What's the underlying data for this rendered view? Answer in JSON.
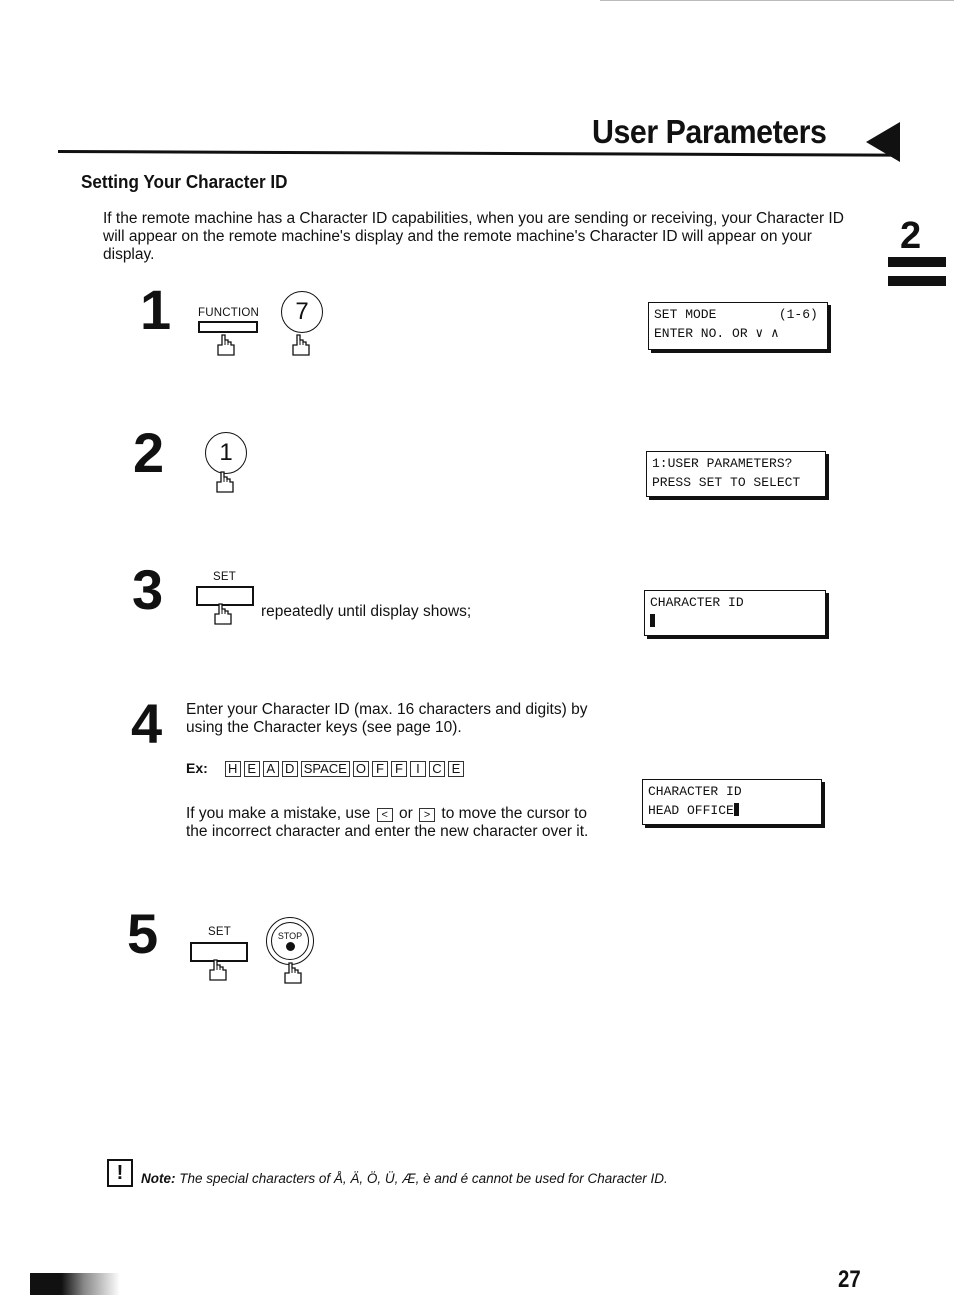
{
  "header": {
    "title": "User Parameters",
    "chapter_number": "2"
  },
  "section": {
    "title": "Setting Your Character ID",
    "intro": "If the remote machine has a Character ID capabilities, when you are sending or receiving, your Character ID will appear on the remote machine's display and the remote machine's Character ID will appear on your display."
  },
  "steps": [
    {
      "number": "1",
      "keys": {
        "function_label": "FUNCTION",
        "round_key": "7"
      },
      "display": {
        "line1": "SET MODE        (1-6)",
        "line2": "ENTER NO. OR ∨ ∧"
      }
    },
    {
      "number": "2",
      "keys": {
        "round_key": "1"
      },
      "display": {
        "line1": "1:USER PARAMETERS?",
        "line2": "PRESS SET TO SELECT"
      }
    },
    {
      "number": "3",
      "keys": {
        "set_label": "SET"
      },
      "text": "repeatedly until display shows;",
      "display": {
        "line1": "CHARACTER ID",
        "line2": ""
      }
    },
    {
      "number": "4",
      "text": "Enter your Character ID (max. 16 characters and digits) by using the Character keys (see page 10).",
      "example_label": "Ex:",
      "example_keys": [
        "H",
        "E",
        "A",
        "D",
        "SPACE",
        "O",
        "F",
        "F",
        "I",
        "C",
        "E"
      ],
      "mistake_text_1": "If you make a mistake, use",
      "left_key": "<",
      "mistake_or": "or",
      "right_key": ">",
      "mistake_text_2": "to move the cursor to the incorrect character and enter the new character over it.",
      "display": {
        "line1": "CHARACTER ID",
        "line2": "HEAD OFFICE"
      }
    },
    {
      "number": "5",
      "keys": {
        "set_label": "SET",
        "stop_label": "STOP"
      }
    }
  ],
  "note": {
    "icon": "!",
    "label": "Note:",
    "text": "The special characters of Å, Ä, Ö, Ü, Æ, è and é cannot be used for Character ID."
  },
  "footer": {
    "page_number": "27"
  }
}
